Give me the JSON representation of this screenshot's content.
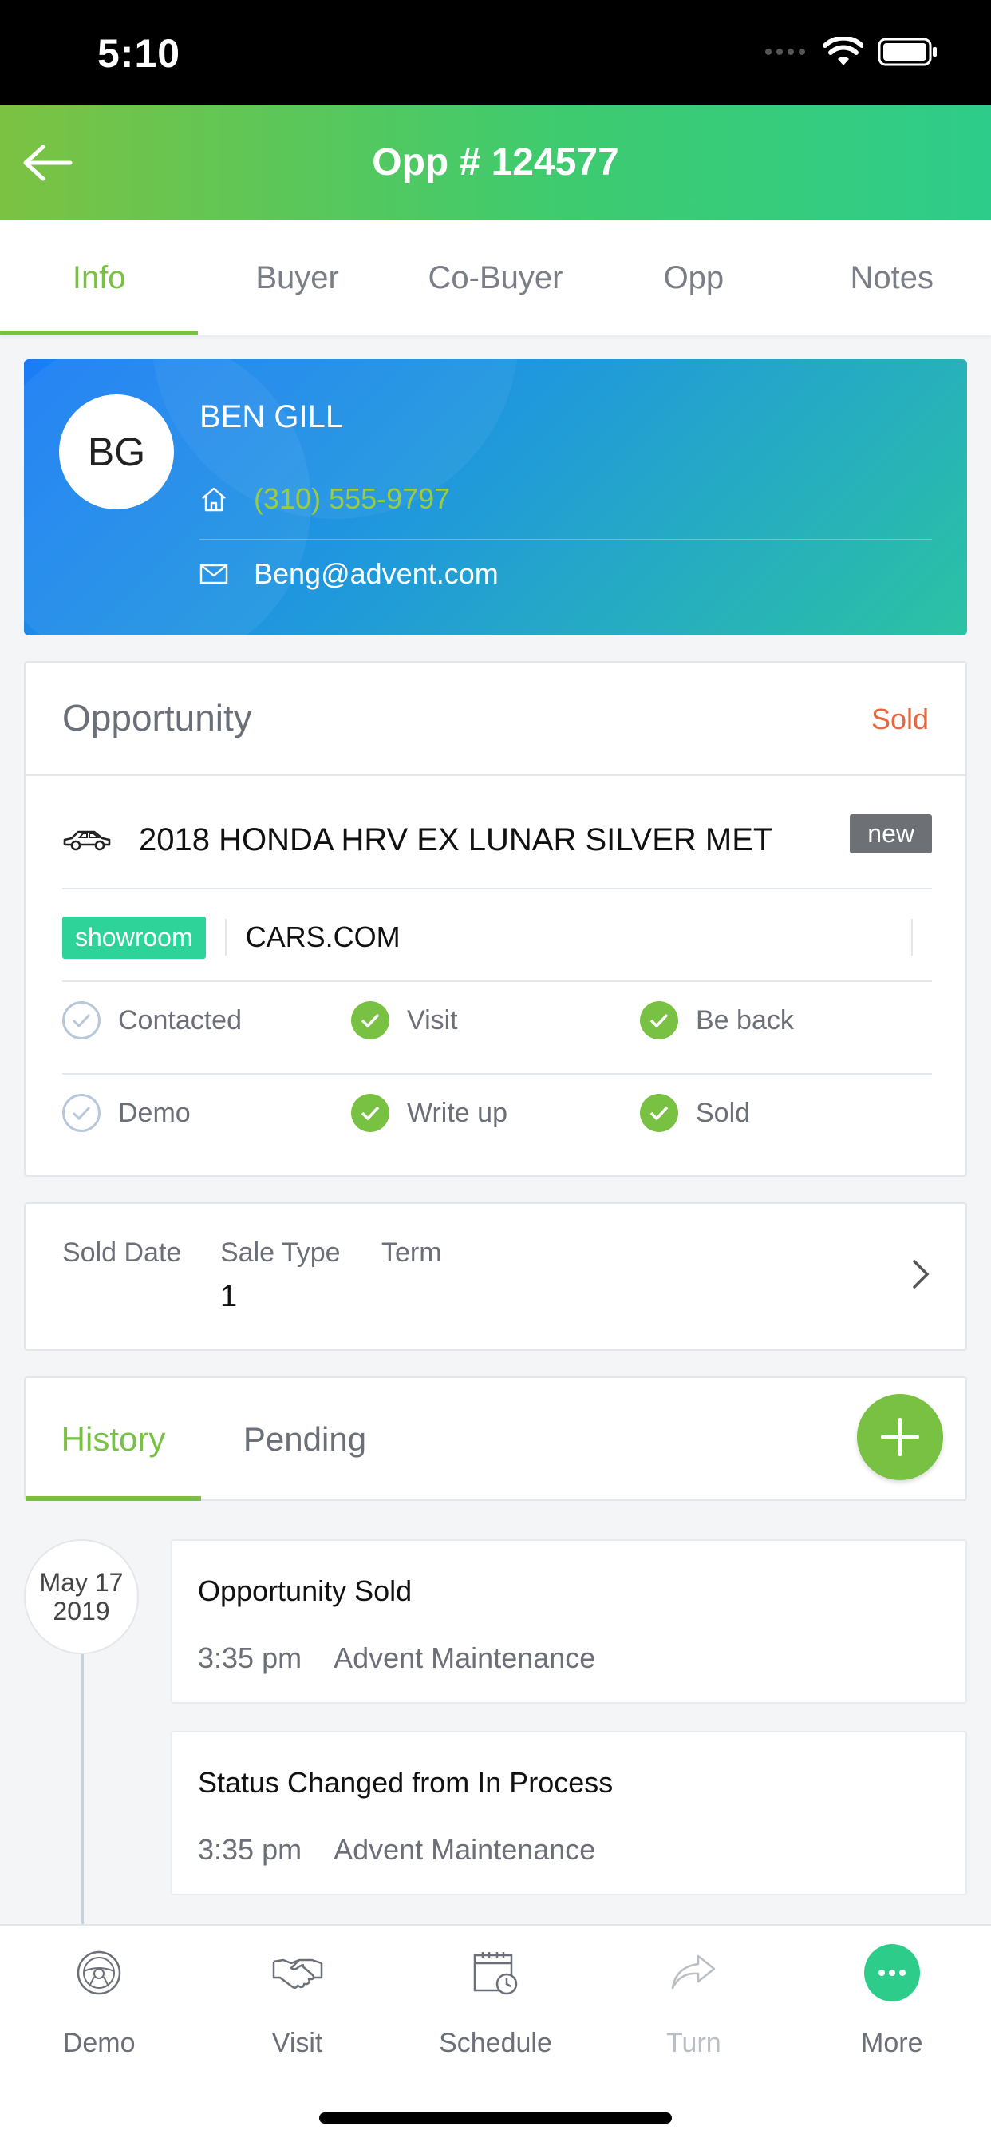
{
  "status_bar": {
    "time": "5:10"
  },
  "nav": {
    "title": "Opp # 124577"
  },
  "tabs": [
    {
      "label": "Info",
      "active": true
    },
    {
      "label": "Buyer",
      "active": false
    },
    {
      "label": "Co-Buyer",
      "active": false
    },
    {
      "label": "Opp",
      "active": false
    },
    {
      "label": "Notes",
      "active": false
    }
  ],
  "contact": {
    "initials": "BG",
    "name": "BEN GILL",
    "phone": "(310) 555-9797",
    "email": "Beng@advent.com"
  },
  "opportunity": {
    "title": "Opportunity",
    "status": "Sold",
    "vehicle": "2018 HONDA HRV EX LUNAR SILVER MET",
    "vehicle_badge": "new",
    "source_badge": "showroom",
    "source": "CARS.COM",
    "steps": [
      {
        "label": "Contacted",
        "done": false
      },
      {
        "label": "Visit",
        "done": true
      },
      {
        "label": "Be back",
        "done": true
      },
      {
        "label": "Demo",
        "done": false
      },
      {
        "label": "Write up",
        "done": true
      },
      {
        "label": "Sold",
        "done": true
      }
    ]
  },
  "sale": {
    "sold_date_label": "Sold Date",
    "sold_date_value": "",
    "sale_type_label": "Sale Type",
    "sale_type_value": "1",
    "term_label": "Term",
    "term_value": ""
  },
  "history": {
    "tabs": [
      {
        "label": "History",
        "active": true
      },
      {
        "label": "Pending",
        "active": false
      }
    ],
    "date_month_day": "May 17",
    "date_year": "2019",
    "events": [
      {
        "title": "Opportunity Sold",
        "time": "3:35 pm",
        "user": "Advent Maintenance"
      },
      {
        "title": "Status Changed from In Process",
        "time": "3:35 pm",
        "user": "Advent Maintenance"
      }
    ]
  },
  "bottom_nav": [
    {
      "label": "Demo",
      "icon": "steering-wheel-icon"
    },
    {
      "label": "Visit",
      "icon": "handshake-icon"
    },
    {
      "label": "Schedule",
      "icon": "calendar-clock-icon"
    },
    {
      "label": "Turn",
      "icon": "share-arrow-icon",
      "disabled": true
    },
    {
      "label": "More",
      "icon": "more-dots-icon"
    }
  ],
  "colors": {
    "accent_green": "#79c142",
    "header_gradient_start": "#7cc242",
    "header_gradient_end": "#2ecc8a",
    "sold_orange": "#e8663b",
    "card_gradient_start": "#1a7cf5",
    "card_gradient_end": "#2cc2a3"
  }
}
